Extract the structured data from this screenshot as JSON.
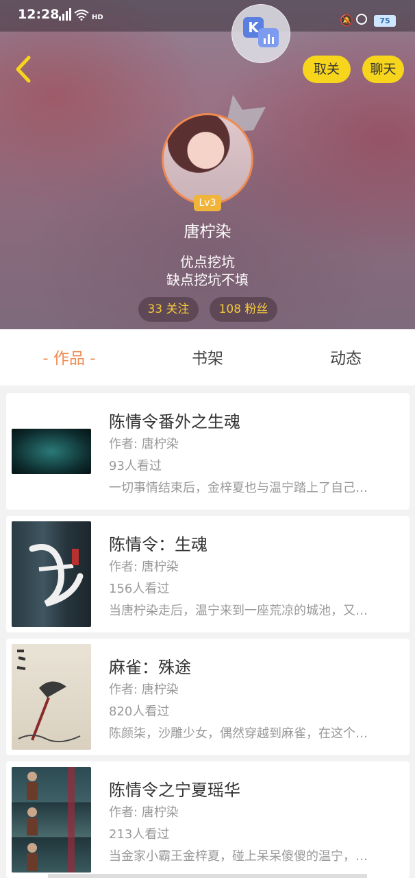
{
  "status_bar": {
    "time": "12:28",
    "network": "4G",
    "hd": "HD",
    "battery": "75"
  },
  "float_app": {
    "letter": "K"
  },
  "header": {
    "unfollow_label": "取关",
    "chat_label": "聊天",
    "level": "Lv3",
    "username": "唐柠染",
    "bio_line1": "优点挖坑",
    "bio_line2": "缺点挖坑不填",
    "following": "33 关注",
    "fans": "108 粉丝"
  },
  "tabs": [
    {
      "label": "- 作品 -",
      "active": true
    },
    {
      "label": "书架",
      "active": false
    },
    {
      "label": "动态",
      "active": false
    }
  ],
  "works": [
    {
      "title": "陈情令番外之生魂",
      "author": "作者: 唐柠染",
      "views": "93人看过",
      "desc": "一切事情结束后，金梓夏也与温宁踏上了自己…"
    },
    {
      "title": "陈情令：生魂",
      "author": "作者: 唐柠染",
      "views": "156人看过",
      "desc": "当唐柠染走后，温宁来到一座荒凉的城池，又…"
    },
    {
      "title": "麻雀：殊途",
      "author": "作者: 唐柠染",
      "views": "820人看过",
      "desc": "陈颜柒，沙雕少女，偶然穿越到麻雀，在这个…"
    },
    {
      "title": "陈情令之宁夏瑶华",
      "author": "作者: 唐柠染",
      "views": "213人看过",
      "desc": "当金家小霸王金梓夏，碰上呆呆傻傻的温宁，…"
    }
  ],
  "colors": {
    "accent": "#f08a50",
    "button_yellow": "#f7d51c",
    "stat_text": "#f5c93c",
    "level_badge": "#f0b43a"
  }
}
